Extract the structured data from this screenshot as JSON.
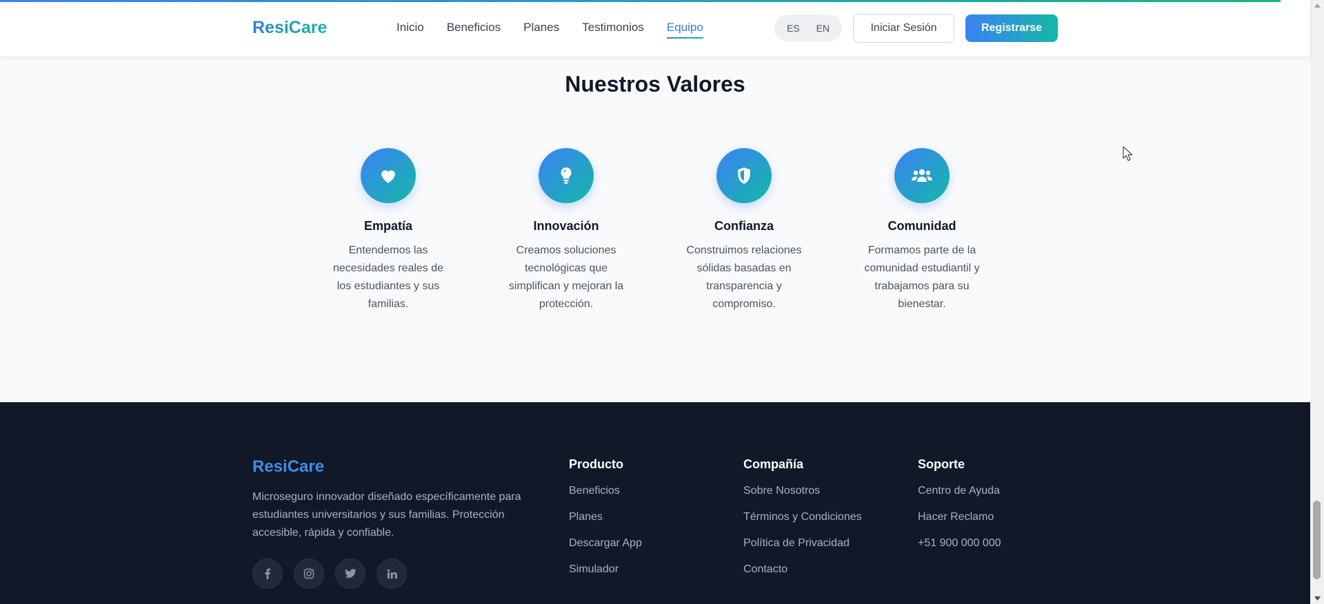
{
  "brand": {
    "name": "ResiCare"
  },
  "nav": {
    "items": [
      {
        "label": "Inicio"
      },
      {
        "label": "Beneficios"
      },
      {
        "label": "Planes"
      },
      {
        "label": "Testimonios"
      },
      {
        "label": "Equipo",
        "active": true
      }
    ]
  },
  "language": {
    "options": [
      "ES",
      "EN"
    ]
  },
  "auth": {
    "login_label": "Iniciar Sesión",
    "register_label": "Registrarse"
  },
  "values": {
    "title": "Nuestros Valores",
    "items": [
      {
        "icon": "heart-icon",
        "title": "Empatía",
        "description": "Entendemos las necesidades reales de los estudiantes y sus familias."
      },
      {
        "icon": "lightbulb-icon",
        "title": "Innovación",
        "description": "Creamos soluciones tecnológicas que simplifican y mejoran la protección."
      },
      {
        "icon": "shield-icon",
        "title": "Confianza",
        "description": "Construimos relaciones sólidas basadas en transparencia y compromiso."
      },
      {
        "icon": "users-icon",
        "title": "Comunidad",
        "description": "Formamos parte de la comunidad estudiantil y trabajamos para su bienestar."
      }
    ]
  },
  "footer": {
    "brand": "ResiCare",
    "description": "Microseguro innovador diseñado específicamente para estudiantes universitarios y sus familias. Protección accesible, rápida y confiable.",
    "socials": [
      "facebook-icon",
      "instagram-icon",
      "twitter-icon",
      "linkedin-icon"
    ],
    "columns": [
      {
        "title": "Producto",
        "links": [
          "Beneficios",
          "Planes",
          "Descargar App",
          "Simulador"
        ]
      },
      {
        "title": "Compañía",
        "links": [
          "Sobre Nosotros",
          "Términos y Condiciones",
          "Política de Privacidad",
          "Contacto"
        ]
      },
      {
        "title": "Soporte",
        "links": [
          "Centro de Ayuda",
          "Hacer Reclamo",
          "+51 900 000 000"
        ]
      }
    ]
  },
  "colors": {
    "accent_blue": "#3b82f6",
    "accent_teal": "#14b8a6",
    "footer_bg": "#111827",
    "active_nav": "#3182ce"
  }
}
